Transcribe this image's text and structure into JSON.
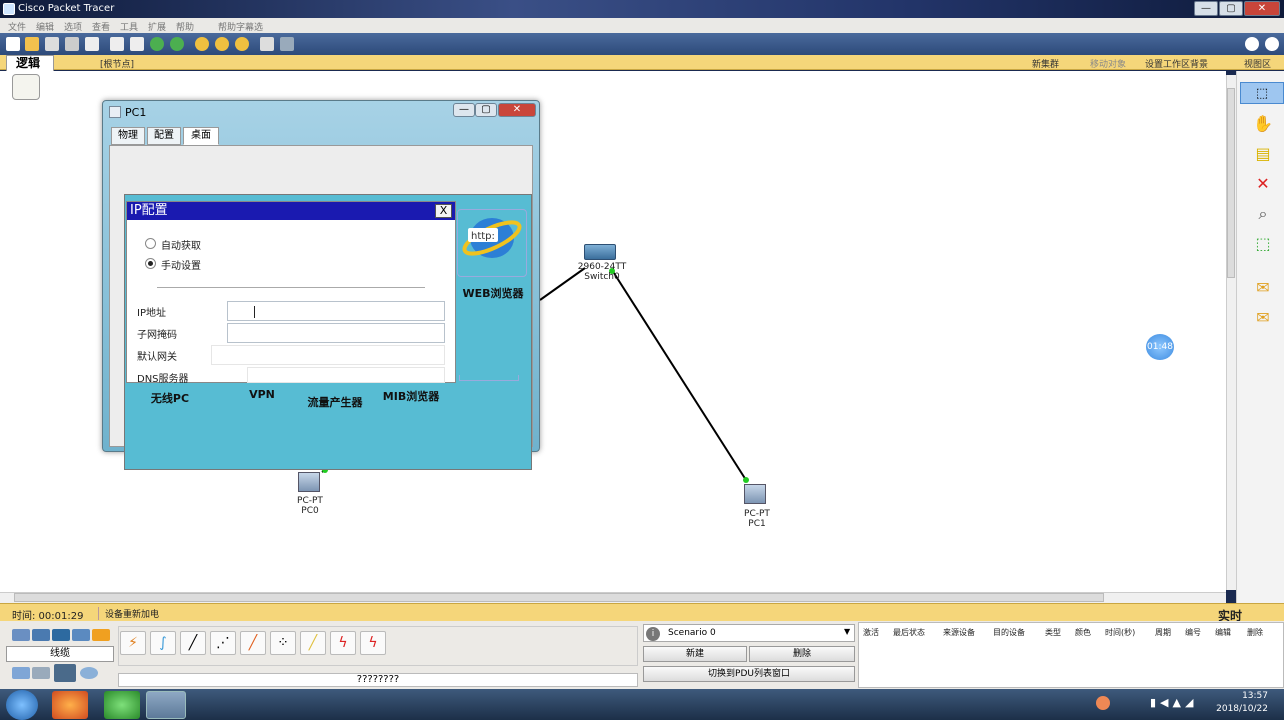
{
  "window": {
    "title": "Cisco Packet Tracer",
    "min": "—",
    "max": "▢",
    "close": "✕"
  },
  "menu": [
    "文件",
    "编辑",
    "选项",
    "查看",
    "工具",
    "扩展",
    "帮助",
    "帮助字幕选"
  ],
  "logic_bar": {
    "tab": "逻辑",
    "root": "[根节点]",
    "new_cluster": "新集群",
    "move_object": "移动对象",
    "set_background": "设置工作区背景",
    "viewport": "视图区"
  },
  "devices": {
    "switch": {
      "model": "2960-24TT",
      "name": "Switch0"
    },
    "pc0": {
      "type": "PC-PT",
      "name": "PC0"
    },
    "pc1": {
      "type": "PC-PT",
      "name": "PC1"
    }
  },
  "timer_badge": "01:48",
  "pc_window": {
    "title": "PC1",
    "tabs": [
      "物理",
      "配置",
      "桌面"
    ],
    "active_tab": "桌面",
    "desktop_apps": {
      "web": "WEB浏览器",
      "http": "http:",
      "wireless": "无线PC",
      "vpn": "VPN",
      "traffic": "流量产生器",
      "mib": "MIB浏览器"
    },
    "ip_config": {
      "title": "IP配置",
      "close": "X",
      "dhcp": "自动获取",
      "static": "手动设置",
      "selected": "手动设置",
      "fields": {
        "ip": "IP地址",
        "mask": "子网掩码",
        "gateway": "默认网关",
        "dns": "DNS服务器"
      },
      "values": {
        "ip": "",
        "mask": "",
        "gateway": "",
        "dns": ""
      }
    }
  },
  "status": {
    "time": "时间: 00:01:29",
    "power": "设备重新加电",
    "mode": "实时"
  },
  "bottom": {
    "cable_label": "线缆",
    "question": "????????",
    "scenario": "Scenario 0",
    "new": "新建",
    "delete": "删除",
    "toggle_pdu": "切换到PDU列表窗口",
    "pdu_columns": [
      "激活",
      "最后状态",
      "来源设备",
      "目的设备",
      "类型",
      "颜色",
      "时间(秒)",
      "周期",
      "编号",
      "编辑",
      "删除"
    ]
  },
  "taskbar": {
    "time": "13:57",
    "date": "2018/10/22"
  },
  "colors": {
    "accent_yellow": "#f5d67a",
    "desktop_teal": "#57bcd3",
    "ipconfig_header": "#1a1ab0"
  }
}
